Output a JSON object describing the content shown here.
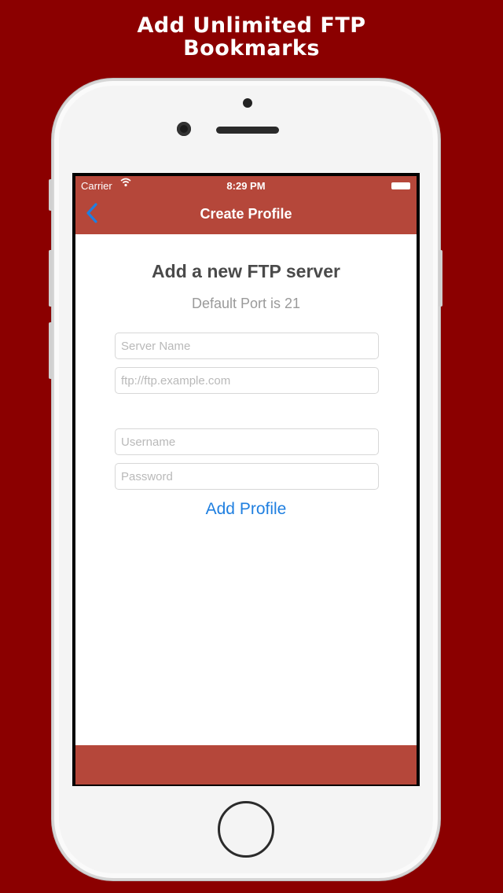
{
  "promo": {
    "line1": "Add Unlimited FTP",
    "line2": "Bookmarks"
  },
  "status_bar": {
    "carrier": "Carrier",
    "wifi_icon": "wifi-icon",
    "time": "8:29 PM",
    "battery_icon": "battery-icon"
  },
  "nav": {
    "back_icon": "chevron-left-icon",
    "title": "Create Profile"
  },
  "form": {
    "heading": "Add a new FTP server",
    "subheading": "Default Port is 21",
    "server_name": {
      "value": "",
      "placeholder": "Server Name"
    },
    "server_url": {
      "value": "",
      "placeholder": "ftp://ftp.example.com"
    },
    "username": {
      "value": "",
      "placeholder": "Username"
    },
    "password": {
      "value": "",
      "placeholder": "Password"
    },
    "submit_label": "Add Profile"
  },
  "colors": {
    "background": "#8b0000",
    "bar": "#b5473a",
    "link": "#1f7fe0"
  }
}
